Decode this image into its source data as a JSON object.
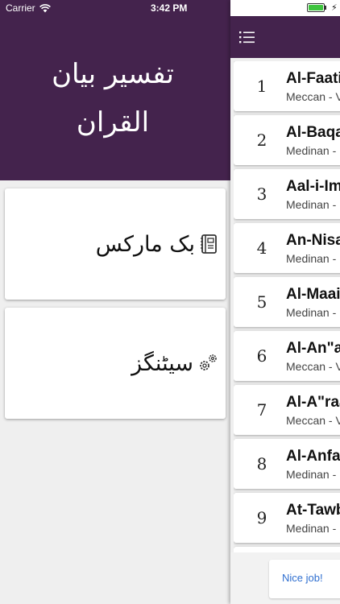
{
  "status_bar": {
    "carrier": "Carrier",
    "time": "3:42 PM",
    "charging": "⚡"
  },
  "menu": {
    "title_line1": "تفسیر بیان",
    "title_line2": "القران",
    "items": [
      {
        "label": "بک مارکس",
        "icon": "bookmark-book-icon"
      },
      {
        "label": "سیٹنگز",
        "icon": "gears-icon"
      }
    ]
  },
  "surahs": [
    {
      "number": "1",
      "name": "Al-Faatiha",
      "info": "Meccan - V"
    },
    {
      "number": "2",
      "name": "Al-Baqara",
      "info": "Medinan -"
    },
    {
      "number": "3",
      "name": "Aal-i-Imraan",
      "info": "Medinan -"
    },
    {
      "number": "4",
      "name": "An-Nisaa",
      "info": "Medinan -"
    },
    {
      "number": "5",
      "name": "Al-Maaida",
      "info": "Medinan -"
    },
    {
      "number": "6",
      "name": "Al-An\"aam",
      "info": "Meccan - V"
    },
    {
      "number": "7",
      "name": "Al-A\"raaf",
      "info": "Meccan - V"
    },
    {
      "number": "8",
      "name": "Al-Anfaal",
      "info": "Medinan -"
    },
    {
      "number": "9",
      "name": "At-Tawba",
      "info": "Medinan -"
    }
  ],
  "toast": {
    "text": "Nice job!"
  },
  "colors": {
    "brand": "#44234d",
    "battery": "#3ec43e",
    "toast_text": "#2f6fd0"
  }
}
